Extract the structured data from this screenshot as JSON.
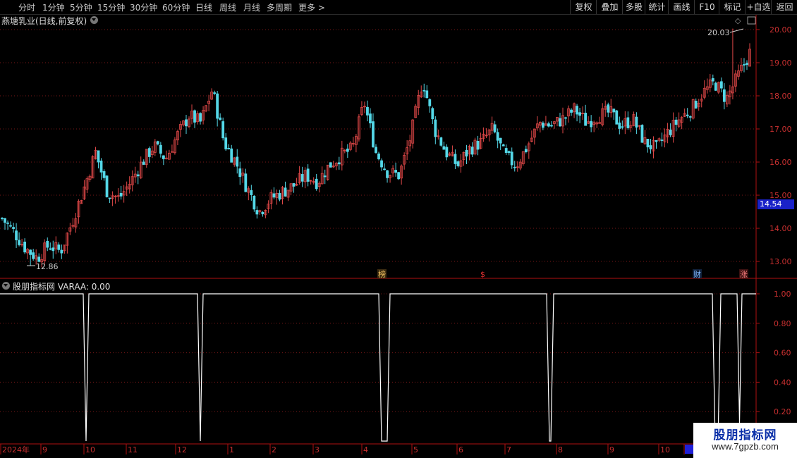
{
  "toolbar": {
    "periods": [
      "分时",
      "1分钟",
      "5分钟",
      "15分钟",
      "30分钟",
      "60分钟",
      "日线",
      "周线",
      "月线",
      "多周期",
      "更多"
    ],
    "more_arrow": ">",
    "right_buttons": [
      "复权",
      "叠加",
      "多股",
      "统计",
      "画线",
      "F10",
      "+自选",
      "返回"
    ]
  },
  "main_chart": {
    "title": "燕塘乳业(日线,前复权)",
    "y_ticks": [
      "20.00",
      "19.00",
      "18.00",
      "17.00",
      "16.00",
      "15.00",
      "14.00",
      "13.00"
    ],
    "current_price": "14.54",
    "high_label": "20.03",
    "low_label": "12.86",
    "markers": [
      "榜",
      "$",
      "财",
      "涨"
    ],
    "colors": {
      "up": "#e04848",
      "down": "#54d8e8",
      "grid": "#7a1818",
      "axis": "#b01010"
    }
  },
  "indicator": {
    "title": "股朋指标网  VARAA: 0.00",
    "y_ticks": [
      "1.00",
      "0.80",
      "0.60",
      "0.40",
      "0.20"
    ]
  },
  "date_axis": {
    "labels": [
      "2024年",
      "9",
      "10",
      "11",
      "12",
      "1",
      "2",
      "3",
      "4",
      "5",
      "6",
      "7",
      "8",
      "9",
      "10",
      "20"
    ]
  },
  "watermark": {
    "name": "股朋指标网",
    "url": "www.7gpzb.com"
  },
  "chart_data": {
    "type": "candlestick",
    "title": "燕塘乳业(日线,前复权)",
    "y_range": [
      12.6,
      20.2
    ],
    "y_ticks": [
      13,
      14,
      15,
      16,
      17,
      18,
      19,
      20
    ],
    "annotations": {
      "high": 20.03,
      "low": 12.86,
      "last": 14.54
    },
    "x_month_labels": [
      "2024年",
      "9",
      "10",
      "11",
      "12",
      "1",
      "2",
      "3",
      "4",
      "5",
      "6",
      "7",
      "8",
      "9",
      "10",
      "20"
    ],
    "approx_close_path": [
      14.3,
      13.9,
      13.4,
      13.1,
      13.5,
      13.3,
      14.2,
      15.2,
      16.3,
      15.1,
      14.9,
      15.4,
      16.0,
      16.5,
      16.1,
      16.8,
      17.4,
      17.2,
      18.2,
      16.6,
      16.0,
      15.2,
      14.5,
      14.9,
      15.1,
      15.3,
      15.6,
      15.4,
      15.9,
      16.2,
      16.4,
      17.8,
      16.3,
      15.7,
      15.6,
      16.8,
      18.5,
      17.0,
      16.3,
      15.9,
      16.4,
      16.6,
      17.0,
      16.2,
      15.9,
      16.5,
      17.2,
      17.1,
      17.3,
      17.6,
      17.2,
      17.4,
      17.5,
      17.1,
      17.3,
      16.6,
      16.4,
      16.9,
      17.3,
      17.6,
      18.1,
      18.4,
      17.9,
      18.6,
      19.3
    ],
    "indicator": {
      "name": "VARAA",
      "value": 0.0,
      "y_range": [
        0,
        1
      ],
      "y_ticks": [
        0.2,
        0.4,
        0.6,
        0.8,
        1.0
      ],
      "baseline": 1.0,
      "drops_to_zero_months": [
        "10",
        "12",
        "4",
        "8",
        "8",
        "20"
      ]
    }
  }
}
